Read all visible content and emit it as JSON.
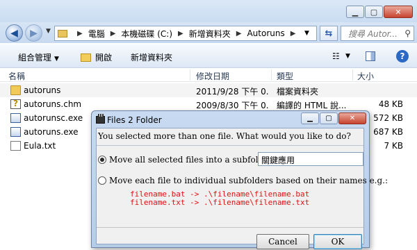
{
  "explorer": {
    "breadcrumb": [
      "電腦",
      "本機磁碟 (C:)",
      "新增資料夾",
      "Autoruns"
    ],
    "search_placeholder": "搜尋 Autor...",
    "toolbar": {
      "organize": "組合管理",
      "open": "開啟",
      "new_folder": "新增資料夾"
    },
    "columns": [
      "名稱",
      "修改日期",
      "類型",
      "大小"
    ],
    "files": [
      {
        "icon": "folder-icon",
        "name": "autoruns",
        "date": "2011/9/28 下午 0...",
        "type": "檔案資料夾",
        "size": ""
      },
      {
        "icon": "chm-file-icon",
        "name": "autoruns.chm",
        "date": "2009/8/30 下午 0...",
        "type": "編譯的 HTML 說...",
        "size": "48 KB"
      },
      {
        "icon": "exe-file-icon",
        "name": "autorunsc.exe",
        "date": "",
        "type": "",
        "size": "572 KB"
      },
      {
        "icon": "exe-file-icon",
        "name": "autoruns.exe",
        "date": "",
        "type": "",
        "size": "687 KB"
      },
      {
        "icon": "text-file-icon",
        "name": "Eula.txt",
        "date": "",
        "type": "",
        "size": "7 KB"
      }
    ]
  },
  "dialog": {
    "title": "Files 2 Folder",
    "question": "You selected more than one file.  What would you like to do?",
    "option1": "Move all selected files into a subfolder named:",
    "folder_name_value": "關鍵應用",
    "option2": "Move each file to individual subfolders based on their names e.g.:",
    "example1": "filename.bat -> .\\filename\\filename.bat",
    "example2": "filename.txt -> .\\filename\\filename.txt",
    "cancel": "Cancel",
    "ok": "OK",
    "selected_option": 1
  },
  "colors": {
    "example_text": "#e01010",
    "title_bar": "#c9dcf1"
  }
}
